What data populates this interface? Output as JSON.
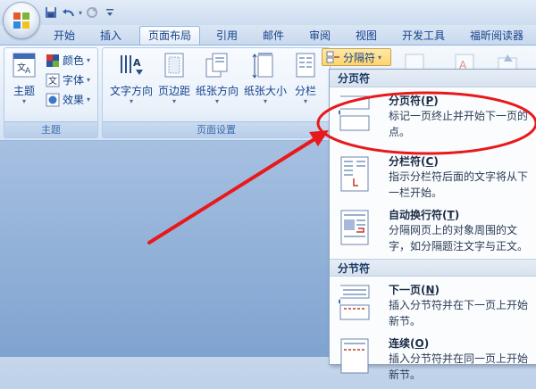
{
  "qat": {
    "icons": [
      "save-icon",
      "undo-icon",
      "redo-icon",
      "customize-icon"
    ]
  },
  "tabs": [
    {
      "label": "开始",
      "active": false
    },
    {
      "label": "插入",
      "active": false
    },
    {
      "label": "页面布局",
      "active": true
    },
    {
      "label": "引用",
      "active": false
    },
    {
      "label": "邮件",
      "active": false
    },
    {
      "label": "审阅",
      "active": false
    },
    {
      "label": "视图",
      "active": false
    },
    {
      "label": "开发工具",
      "active": false
    },
    {
      "label": "福昕阅读器",
      "active": false
    }
  ],
  "ribbon": {
    "theme_group": {
      "label": "主题",
      "themes_button": "主题",
      "colors": "颜色",
      "fonts": "字体",
      "effects": "效果"
    },
    "page_setup_group": {
      "label": "页面设置",
      "text_direction": "文字方向",
      "margins": "页边距",
      "orientation": "纸张方向",
      "size": "纸张大小",
      "columns": "分栏",
      "breaks": "分隔符"
    }
  },
  "dropdown": {
    "page_breaks_header": "分页符",
    "section_breaks_header": "分节符",
    "items": [
      {
        "title": "分页符(",
        "key": "P",
        "title_end": ")",
        "desc": "标记一页终止并开始下一页的点。"
      },
      {
        "title": "分栏符(",
        "key": "C",
        "title_end": ")",
        "desc": "指示分栏符后面的文字将从下一栏开始。"
      },
      {
        "title": "自动换行符(",
        "key": "T",
        "title_end": ")",
        "desc": "分隔网页上的对象周围的文字，如分隔题注文字与正文。"
      },
      {
        "title": "下一页(",
        "key": "N",
        "title_end": ")",
        "desc": "插入分节符并在下一页上开始新节。"
      },
      {
        "title": "连续(",
        "key": "O",
        "title_end": ")",
        "desc": "插入分节符并在同一页上开始新节。"
      }
    ]
  },
  "colors": {
    "annotation_red": "#e8191b",
    "ribbon_text": "#15428b"
  }
}
